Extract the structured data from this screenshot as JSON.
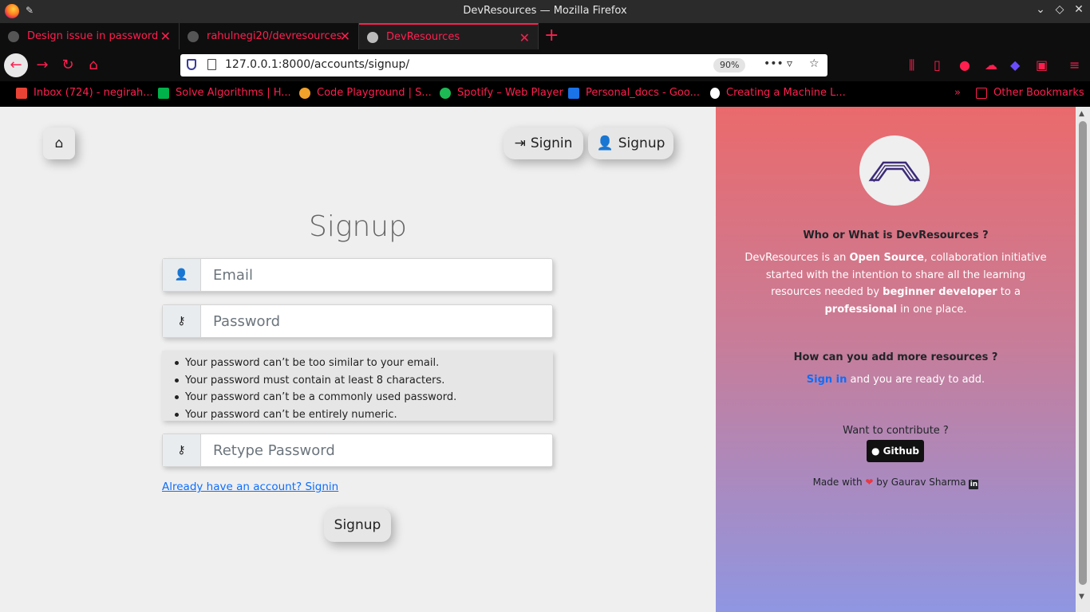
{
  "window": {
    "title": "DevResources — Mozilla Firefox"
  },
  "tabs": [
    {
      "label": "Design issue in password"
    },
    {
      "label": "rahulnegi20/devresources"
    },
    {
      "label": "DevResources"
    }
  ],
  "nav": {
    "url": "127.0.0.1:8000/accounts/signup/",
    "zoom": "90%"
  },
  "bookmarks": [
    {
      "label": "Inbox (724) - negirah...",
      "color": "#ea4335"
    },
    {
      "label": "Solve Algorithms | H...",
      "color": "#00b24a"
    },
    {
      "label": "Code Playground | S...",
      "color": "#f2a12b"
    },
    {
      "label": "Spotify – Web Player",
      "color": "#1db954"
    },
    {
      "label": "Personal_docs - Goo...",
      "color": "#1a73e8"
    },
    {
      "label": "Creating a Machine L...",
      "color": "#ffffff"
    },
    {
      "label": "Other Bookmarks",
      "color": "#ff1f4f"
    }
  ],
  "header": {
    "signin_label": "Signin",
    "signup_label": "Signup"
  },
  "form": {
    "title": "Signup",
    "email_placeholder": "Email",
    "password_placeholder": "Password",
    "retype_placeholder": "Retype Password",
    "help": [
      "Your password can’t be too similar to your email.",
      "Your password must contain at least 8 characters.",
      "Your password can’t be a commonly used password.",
      "Your password can’t be entirely numeric."
    ],
    "login_link": "Already have an account? Signin",
    "submit_label": "Signup"
  },
  "sidebar": {
    "about_heading": "Who or What is DevResources ?",
    "about_p1": "DevResources is an ",
    "about_b1": "Open Source",
    "about_p2": ", collaboration initiative started with the intention to share all the learning resources needed by ",
    "about_b2": "beginner developer",
    "about_p3": " to a ",
    "about_b3": "professional",
    "about_p4": " in one place.",
    "add_heading": "How can you add more resources ?",
    "add_link": "Sign in",
    "add_text": " and you are ready to add.",
    "contribute": "Want to contribute ?",
    "github_label": "Github",
    "made_prefix": "Made with",
    "made_suffix": "by Gaurav Sharma"
  },
  "colors": {
    "accent": "#ff1f4f",
    "link": "#0d6efd",
    "gradient_top": "#ea6a6c",
    "gradient_bottom": "#8f96e2"
  }
}
